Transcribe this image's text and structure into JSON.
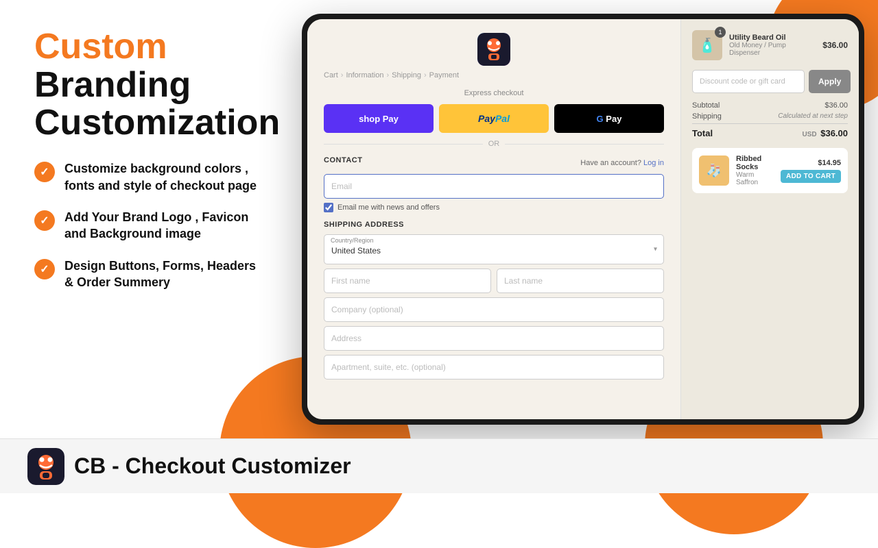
{
  "decorations": {
    "top_right_circle": true,
    "bottom_right_circle": true,
    "bottom_center_circle": true
  },
  "left_panel": {
    "custom_label": "Custom",
    "branding_label": "Branding",
    "customization_label": "Customization",
    "features": [
      {
        "id": "feature-1",
        "text": "Customize background colors , fonts and style of checkout page"
      },
      {
        "id": "feature-2",
        "text": "Add Your Brand Logo , Favicon and Background image"
      },
      {
        "id": "feature-3",
        "text": "Design Buttons, Forms, Headers & Order Summery"
      }
    ]
  },
  "bottom_bar": {
    "title": "CB - Checkout Customizer"
  },
  "checkout": {
    "breadcrumb": {
      "cart": "Cart",
      "information": "Information",
      "shipping": "Shipping",
      "payment": "Payment"
    },
    "express_checkout": {
      "label": "Express checkout",
      "shoppay": "shop Pay",
      "paypal": "PayPal",
      "gpay": "G Pay"
    },
    "or_label": "OR",
    "contact": {
      "section_title": "CONTACT",
      "have_account_text": "Have an account?",
      "log_in": "Log in",
      "email_placeholder": "Email",
      "checkbox_label": "Email me with news and offers"
    },
    "shipping_address": {
      "section_title": "SHIPPING ADDRESS",
      "country_label": "Country/Region",
      "country_value": "United States",
      "first_name_placeholder": "First name",
      "last_name_placeholder": "Last name",
      "company_placeholder": "Company (optional)",
      "address_placeholder": "Address",
      "apartment_placeholder": "Apartment, suite, etc. (optional)"
    }
  },
  "order_summary": {
    "product": {
      "name": "Utility Beard Oil",
      "variant": "Old Money / Pump Dispenser",
      "price": "$36.00",
      "badge": "1"
    },
    "discount": {
      "placeholder": "Discount code or gift card",
      "apply_label": "Apply"
    },
    "subtotal_label": "Subtotal",
    "subtotal_value": "$36.00",
    "shipping_label": "Shipping",
    "shipping_value": "Calculated at next step",
    "total_label": "Total",
    "total_currency": "USD",
    "total_value": "$36.00",
    "upsell": {
      "name": "Ribbed Socks",
      "variant": "Warm Saffron",
      "price": "$14.95",
      "add_to_cart": "ADD TO CART"
    }
  }
}
